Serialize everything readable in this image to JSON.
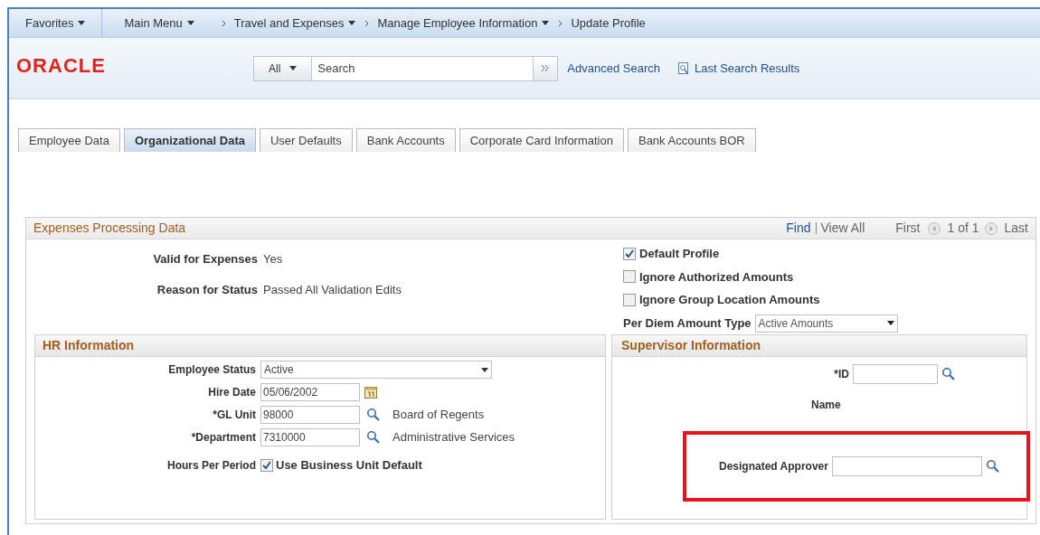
{
  "breadcrumb": [
    {
      "label": "Favorites",
      "dropdown": true
    },
    {
      "label": "Main Menu",
      "dropdown": true
    },
    {
      "label": "Travel and Expenses",
      "dropdown": true
    },
    {
      "label": "Manage Employee Information",
      "dropdown": true
    },
    {
      "label": "Update Profile",
      "dropdown": false
    }
  ],
  "logo": "ORACLE",
  "search": {
    "scope": "All",
    "value": "Search"
  },
  "links": [
    "Advanced Search",
    "Last Search Results"
  ],
  "tabs": [
    {
      "label": "Employee Data",
      "selected": false
    },
    {
      "label": "Organizational Data",
      "selected": true
    },
    {
      "label": "User Defaults",
      "selected": false
    },
    {
      "label": "Bank Accounts",
      "selected": false
    },
    {
      "label": "Corporate Card Information",
      "selected": false
    },
    {
      "label": "Bank Accounts BOR",
      "selected": false
    }
  ],
  "section": {
    "title": "Expenses Processing Data",
    "find": "Find",
    "view_all": "View All",
    "first": "First",
    "count": "1 of 1",
    "last": "Last",
    "fields": [
      {
        "label": "Valid for Expenses",
        "value": "Yes"
      },
      {
        "label": "Reason for Status",
        "value": "Passed All Validation Edits"
      }
    ],
    "checkboxes": [
      {
        "label": "Default Profile",
        "checked": true
      },
      {
        "label": "Ignore Authorized Amounts",
        "checked": false
      },
      {
        "label": "Ignore Group Location Amounts",
        "checked": false
      }
    ],
    "per_diem": {
      "label": "Per Diem Amount Type",
      "value": "Active Amounts"
    }
  },
  "hr": {
    "title": "HR Information",
    "rows": [
      {
        "kind": "select",
        "label": "Employee Status",
        "value": "Active"
      },
      {
        "kind": "date",
        "label": "Hire Date",
        "value": "05/06/2002"
      },
      {
        "kind": "lookup",
        "label": "*GL Unit",
        "value": "98000",
        "description": "Board of Regents"
      },
      {
        "kind": "lookup",
        "label": "*Department",
        "value": "7310000",
        "description": "Administrative Services"
      },
      {
        "kind": "checkbox",
        "label": "Hours Per Period",
        "option": "Use Business Unit Default",
        "checked": true
      }
    ]
  },
  "supervisor": {
    "title": "Supervisor Information",
    "id_label": "*ID",
    "name_label": "Name",
    "approver_label": "Designated Approver",
    "highlighted": true
  }
}
